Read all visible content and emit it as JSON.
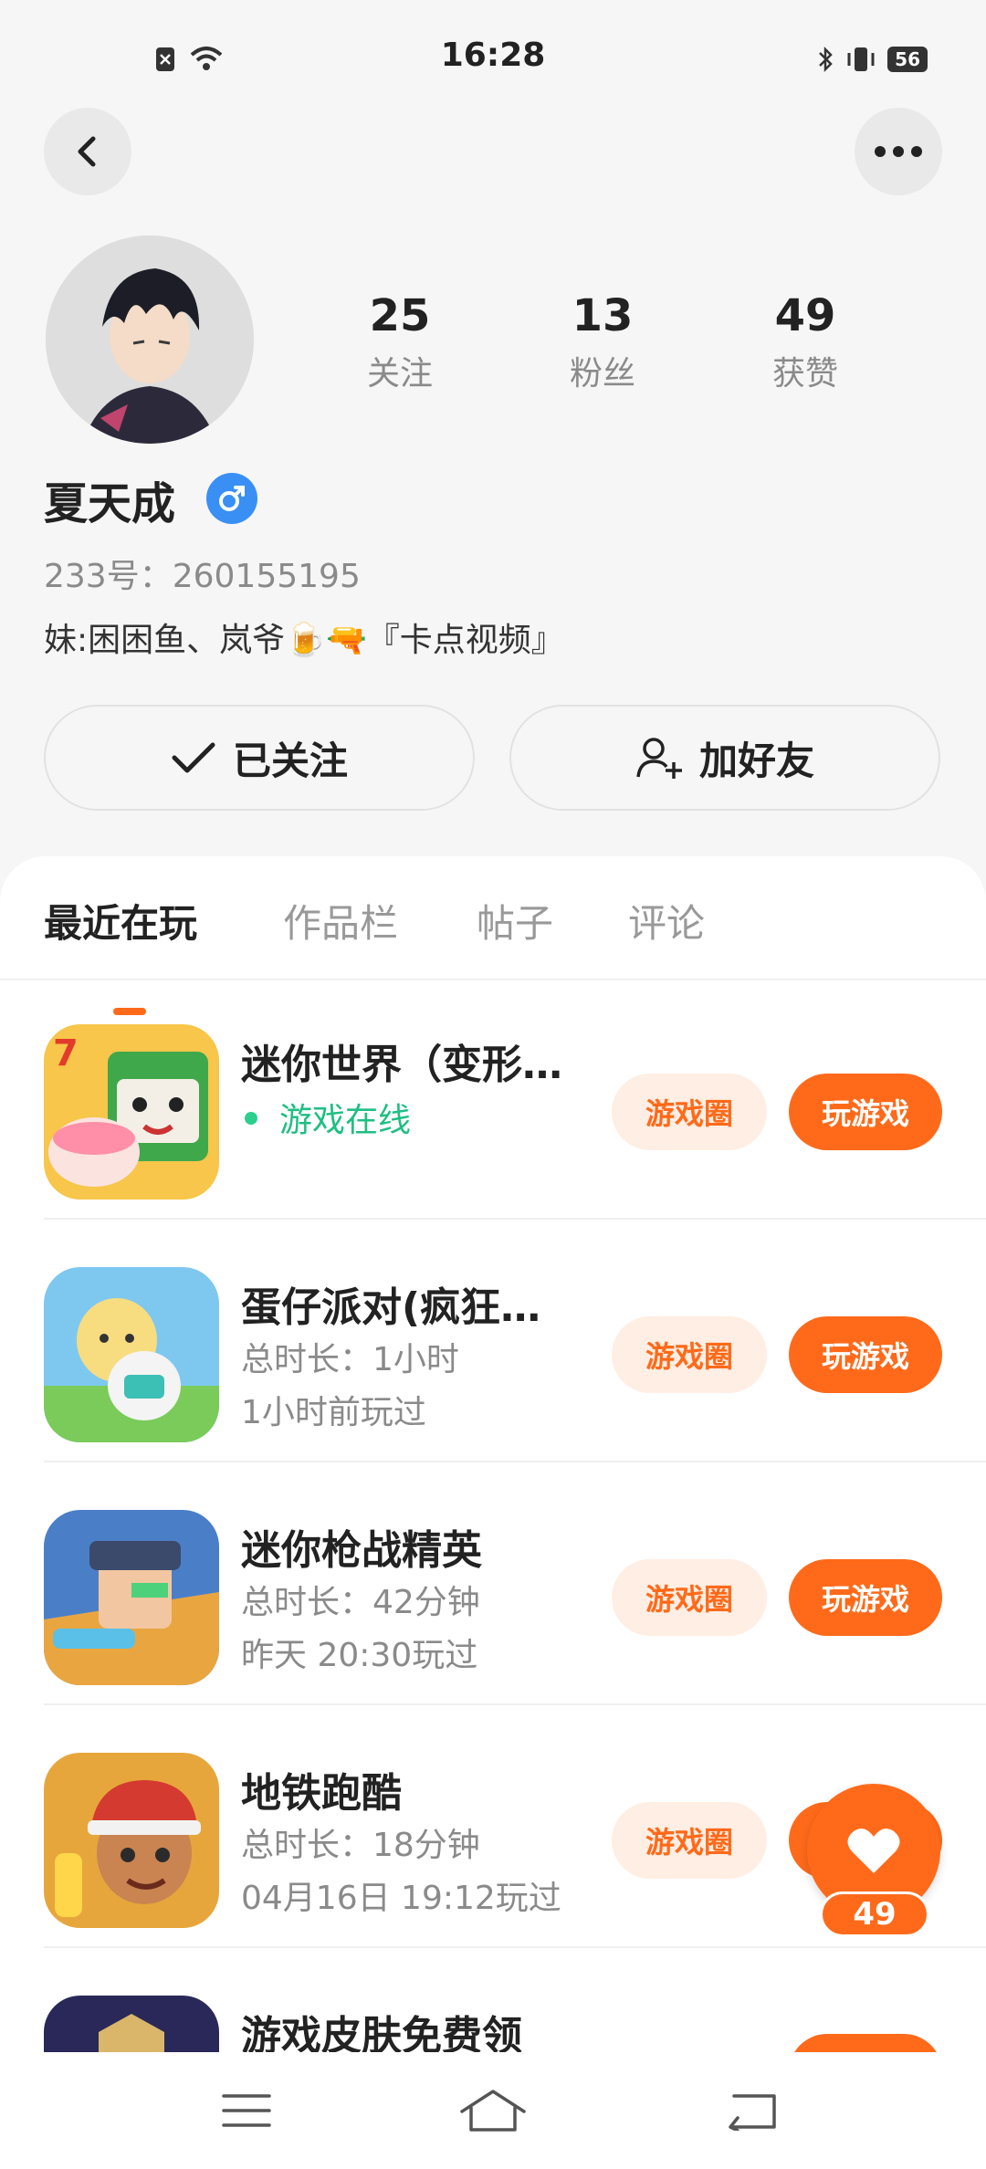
{
  "status_bar": {
    "time": "16:28",
    "battery": "56"
  },
  "profile": {
    "stats": [
      {
        "value": "25",
        "label": "关注"
      },
      {
        "value": "13",
        "label": "粉丝"
      },
      {
        "value": "49",
        "label": "获赞"
      }
    ],
    "name": "夏天成",
    "uid": "233号：260155195",
    "bio": "妹:困困鱼、岚爷🍺🔫『卡点视频』",
    "follow_button": "已关注",
    "add_friend_button": "加好友"
  },
  "tabs": [
    "最近在玩",
    "作品栏",
    "帖子",
    "评论"
  ],
  "games": [
    {
      "name": "迷你世界（变形…",
      "status": "游戏在线",
      "circle_label": "游戏圈",
      "play_label": "玩游戏"
    },
    {
      "name": "蛋仔派对(疯狂…",
      "duration": "总时长：1小时",
      "last_played": "1小时前玩过",
      "circle_label": "游戏圈",
      "play_label": "玩游戏"
    },
    {
      "name": "迷你枪战精英",
      "duration": "总时长：42分钟",
      "last_played": "昨天 20:30玩过",
      "circle_label": "游戏圈",
      "play_label": "玩游戏"
    },
    {
      "name": "地铁跑酷",
      "duration": "总时长：18分钟",
      "last_played": "04月16日 19:12玩过",
      "circle_label": "游戏圈",
      "play_label": "玩游戏"
    },
    {
      "name": "游戏皮肤免费领"
    }
  ],
  "like_float": {
    "count": "49"
  },
  "colors": {
    "accent": "#ff6a1a",
    "online": "#1fbf82",
    "gender": "#3a8ff5"
  }
}
